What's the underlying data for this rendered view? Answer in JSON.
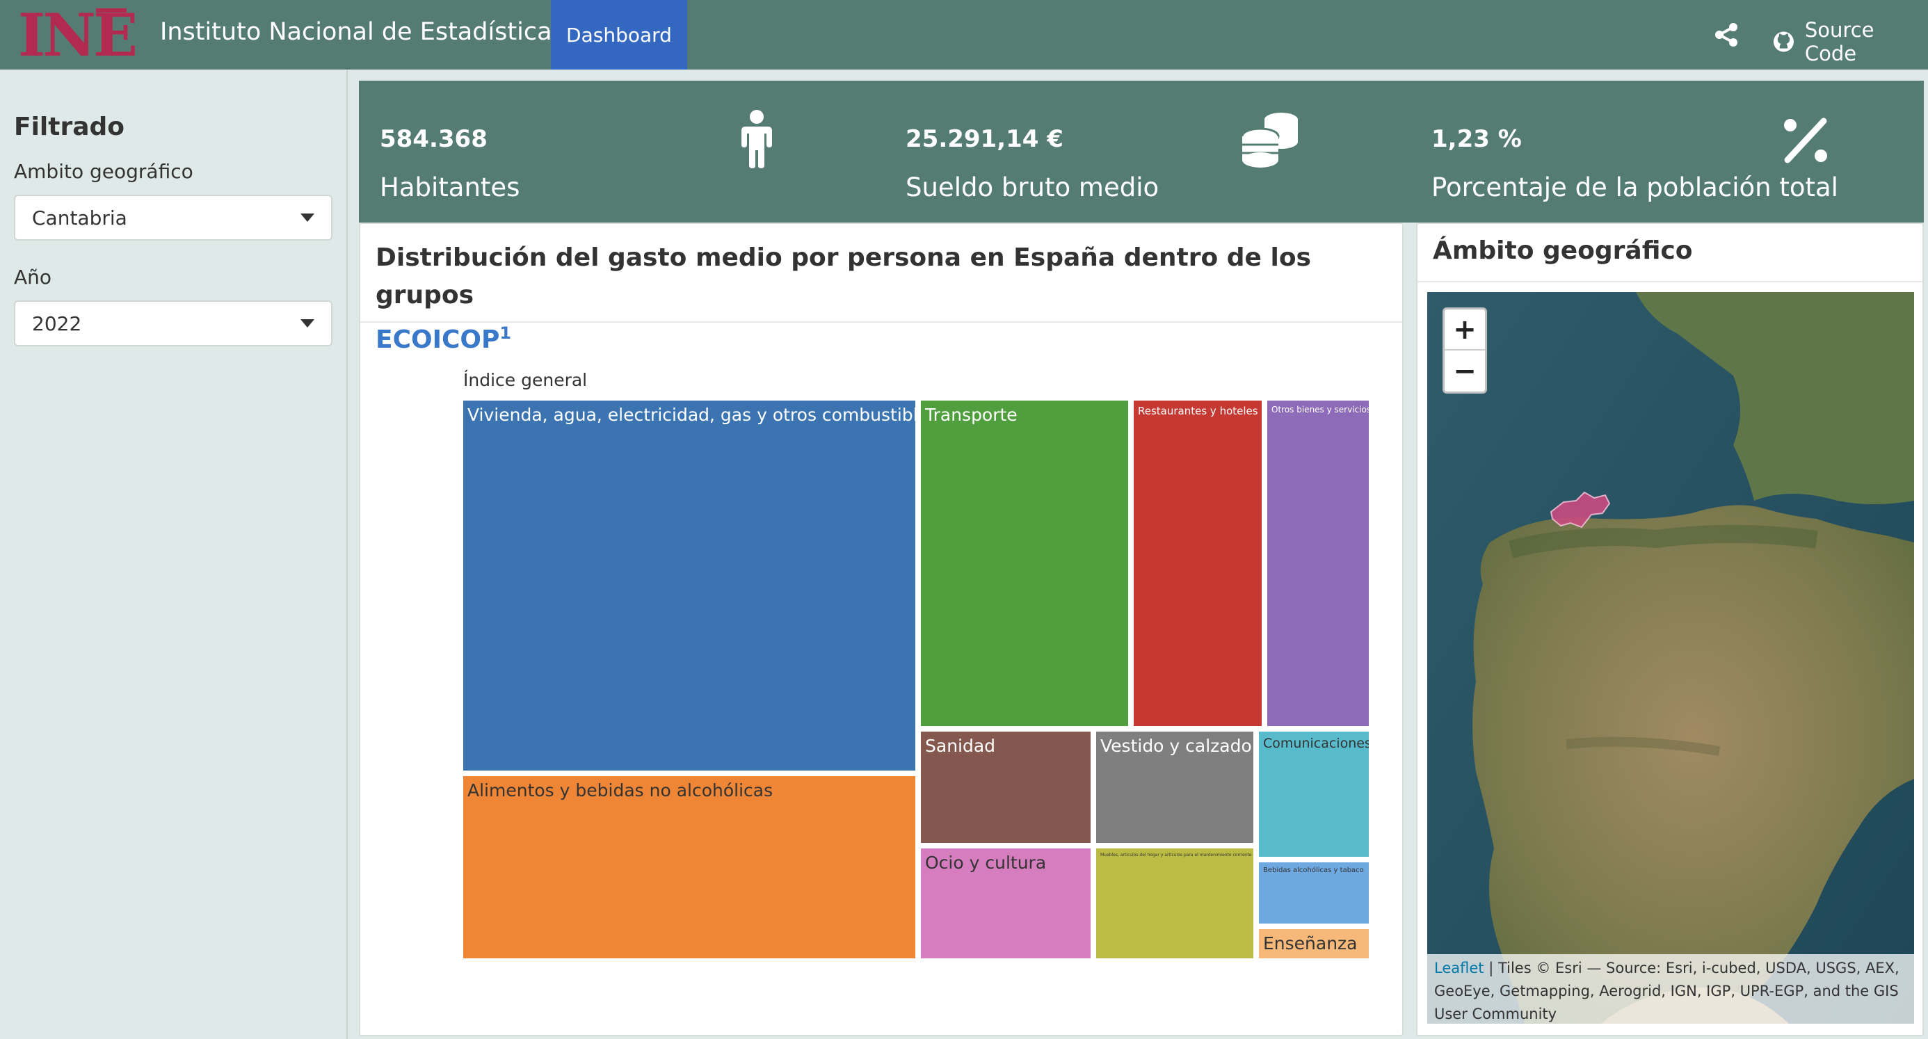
{
  "header": {
    "logo_text": "INE",
    "title": "Instituto Nacional de Estadística",
    "tab_label": "Dashboard",
    "source_label": "Source Code"
  },
  "sidebar": {
    "title": "Filtrado",
    "geo_label": "Ambito geográfico",
    "geo_value": "Cantabria",
    "year_label": "Año",
    "year_value": "2022"
  },
  "kpis": [
    {
      "value": "584.368",
      "label": "Habitantes",
      "icon": "person-icon"
    },
    {
      "value": "25.291,14 €",
      "label": "Sueldo bruto medio",
      "icon": "coins-icon"
    },
    {
      "value": "1,23 %",
      "label": "Porcentaje de la población total",
      "icon": "percent-icon"
    }
  ],
  "treemap_card": {
    "title_main": "Distribución del gasto medio por persona en España dentro de los grupos",
    "title_accent": "ECOICOP",
    "title_sup": "1"
  },
  "map_card": {
    "title": "Ámbito geográfico",
    "zoom_in": "+",
    "zoom_out": "−",
    "attribution_link": "Leaflet",
    "attribution_text": " | Tiles © Esri — Source: Esri, i-cubed, USDA, USGS, AEX, GeoEye, Getmapping, Aerogrid, IGN, IGP, UPR-EGP, and the GIS User Community"
  },
  "chart_data": {
    "type": "treemap",
    "root": "Índice general",
    "tiles": [
      {
        "label": "Vivienda, agua, electricidad, gas y otros combustibles",
        "color": "#3b74b0"
      },
      {
        "label": "Alimentos y bebidas no alcohólicas",
        "color": "#ef8636"
      },
      {
        "label": "Transporte",
        "color": "#519e3e"
      },
      {
        "label": "Restaurantes y hoteles",
        "color": "#c53932"
      },
      {
        "label": "Otros bienes y servicios",
        "color": "#8d6bb8"
      },
      {
        "label": "Sanidad",
        "color": "#84584e"
      },
      {
        "label": "Vestido y calzado",
        "color": "#7f7f7f"
      },
      {
        "label": "Comunicaciones",
        "color": "#57bbcc"
      },
      {
        "label": "Ocio y cultura",
        "color": "#d57dbe"
      },
      {
        "label": "Muebles, artículos del hogar y artículos para el mantenimiento corriente del hogar",
        "color": "#bcbc45"
      },
      {
        "label": "Bebidas alcohólicas y tabaco",
        "color": "#6ea8e0"
      },
      {
        "label": "Enseñanza",
        "color": "#f7b97a"
      }
    ]
  }
}
